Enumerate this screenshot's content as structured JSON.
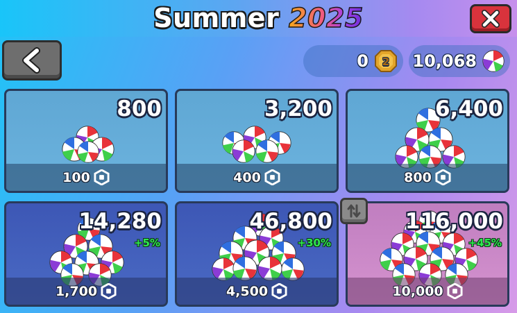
{
  "header": {
    "title_word": "Summer",
    "title_year": "2025"
  },
  "currencies": {
    "coins": {
      "amount": "0",
      "icon": "gold-coin-2-icon",
      "badge": "2"
    },
    "beach_balls": {
      "amount": "10,068",
      "icon": "beach-ball-icon"
    }
  },
  "packs": [
    {
      "amount": "800",
      "bonus": "",
      "price": "100"
    },
    {
      "amount": "3,200",
      "bonus": "",
      "price": "400"
    },
    {
      "amount": "6,400",
      "bonus": "",
      "price": "800"
    },
    {
      "amount": "14,280",
      "bonus": "+5%",
      "price": "1,700"
    },
    {
      "amount": "46,800",
      "bonus": "+30%",
      "price": "4,500"
    },
    {
      "amount": "116,000",
      "bonus": "+45%",
      "price": "10,000"
    }
  ],
  "colors": {
    "close_red": "#d8333c",
    "bonus_green": "#2ee84e",
    "ball_red": "#e8333a",
    "ball_green": "#3fcf4a",
    "ball_purple": "#8b3bd6",
    "ball_blue": "#2f6fe0"
  }
}
